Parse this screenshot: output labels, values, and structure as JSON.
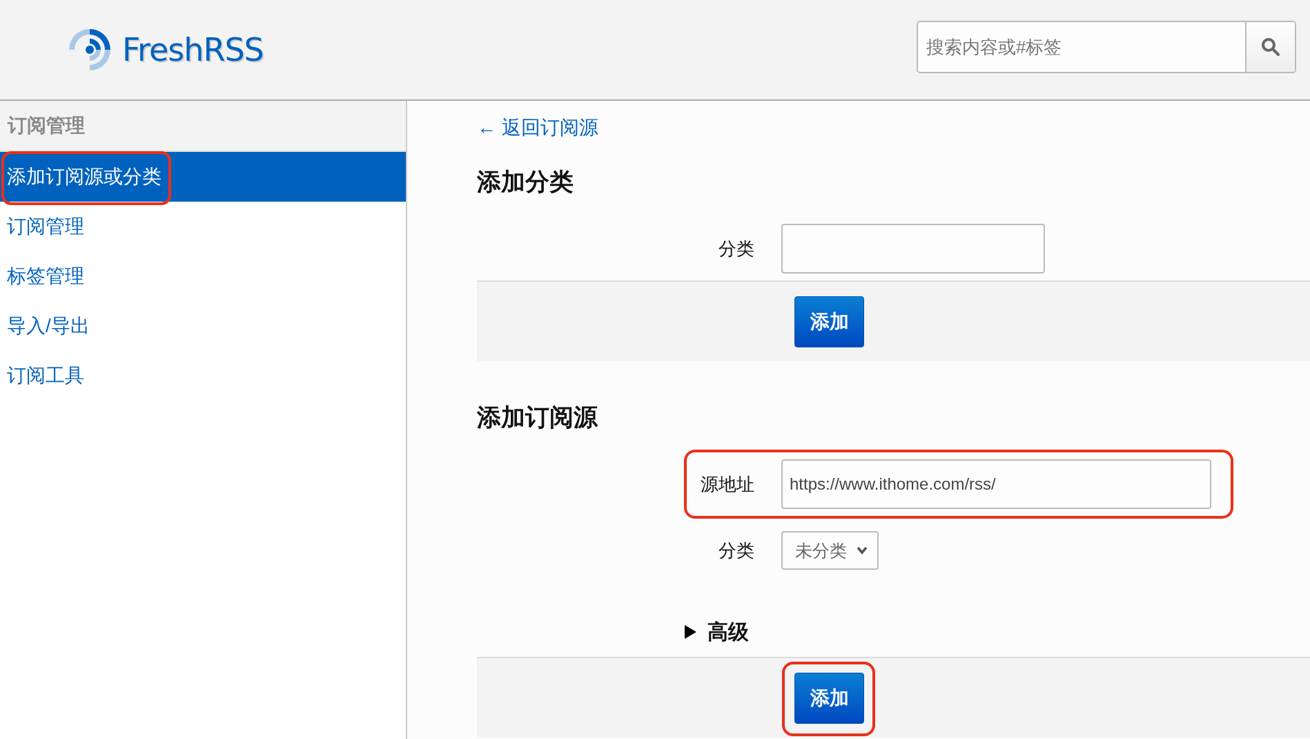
{
  "header": {
    "logo": "FreshRSS",
    "search": {
      "placeholder": "搜索内容或#标签"
    }
  },
  "sidebar": {
    "title": "订阅管理",
    "items": [
      {
        "label": "添加订阅源或分类",
        "selected": true,
        "highlighted": true
      },
      {
        "label": "订阅管理",
        "selected": false,
        "highlighted": false
      },
      {
        "label": "标签管理",
        "selected": false,
        "highlighted": false
      },
      {
        "label": "导入/导出",
        "selected": false,
        "highlighted": false
      },
      {
        "label": "订阅工具",
        "selected": false,
        "highlighted": false
      }
    ]
  },
  "main": {
    "back_link": "← 返回订阅源",
    "category_section": {
      "title": "添加分类",
      "field": {
        "label": "分类"
      },
      "button": {
        "label": "添加",
        "highlighted": false
      }
    },
    "feed_section": {
      "title": "添加订阅源",
      "url_field": {
        "label": "源地址",
        "value": "https://www.ithome.com/rss/",
        "highlighted": true
      },
      "category_field": {
        "label": "分类",
        "value": "未分类"
      },
      "advanced": {
        "label": "高级",
        "expanded": false
      },
      "button": {
        "label": "添加",
        "highlighted": true
      }
    }
  }
}
